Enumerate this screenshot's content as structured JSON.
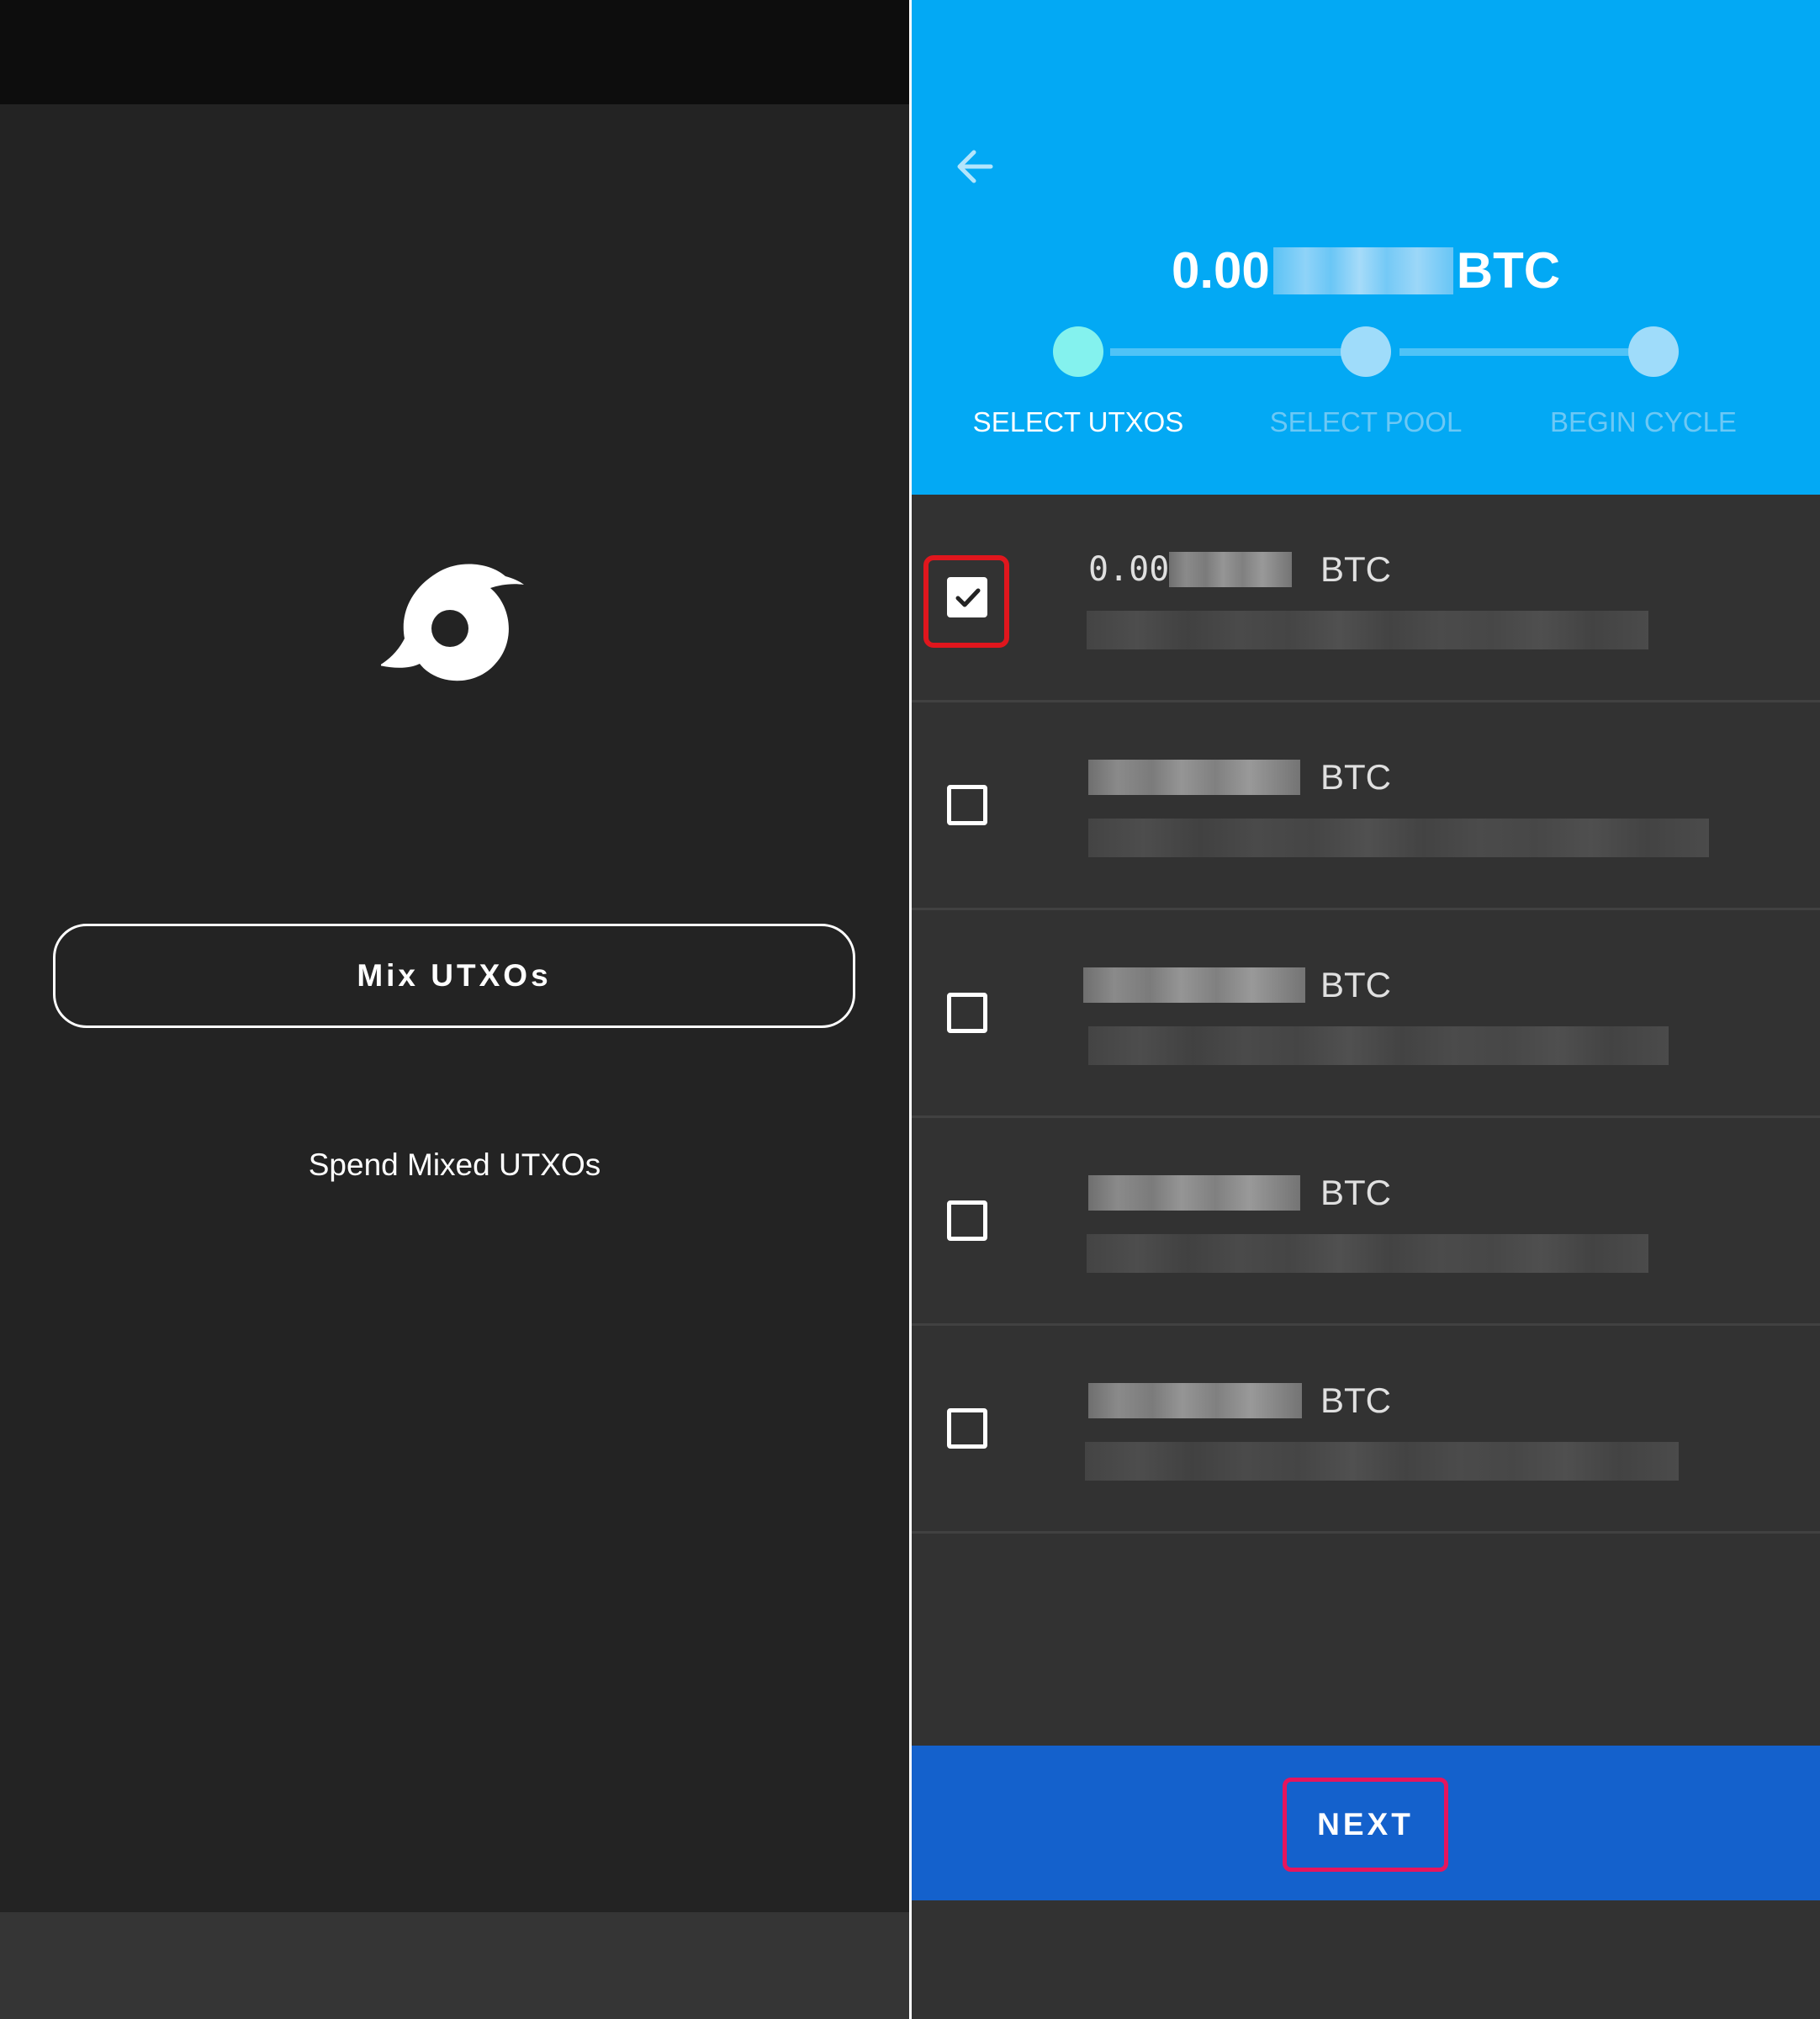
{
  "left_screen": {
    "logo_icon": "whirlpool-cyclone-icon",
    "mix_button_label": "Mix UTXOs",
    "spend_link_label": "Spend Mixed UTXOs"
  },
  "right_screen": {
    "back_icon": "arrow-left-icon",
    "total": {
      "prefix": "0.00",
      "unit": "BTC"
    },
    "steps": [
      {
        "label": "SELECT UTXOS",
        "active": true
      },
      {
        "label": "SELECT POOL",
        "active": false
      },
      {
        "label": "BEGIN CYCLE",
        "active": false
      }
    ],
    "utxos": [
      {
        "amount_prefix": "0.00",
        "unit": "BTC",
        "checked": true
      },
      {
        "amount_prefix": "",
        "unit": "BTC",
        "checked": false
      },
      {
        "amount_prefix": "",
        "unit": "BTC",
        "checked": false
      },
      {
        "amount_prefix": "",
        "unit": "BTC",
        "checked": false
      },
      {
        "amount_prefix": "",
        "unit": "BTC",
        "checked": false
      }
    ],
    "next_button_label": "NEXT"
  },
  "colors": {
    "header_blue": "#03a9f4",
    "next_bar_blue": "#1461cc",
    "highlight_red": "#e0161d",
    "highlight_pink": "#e6155d",
    "active_step": "#84f2ee"
  }
}
